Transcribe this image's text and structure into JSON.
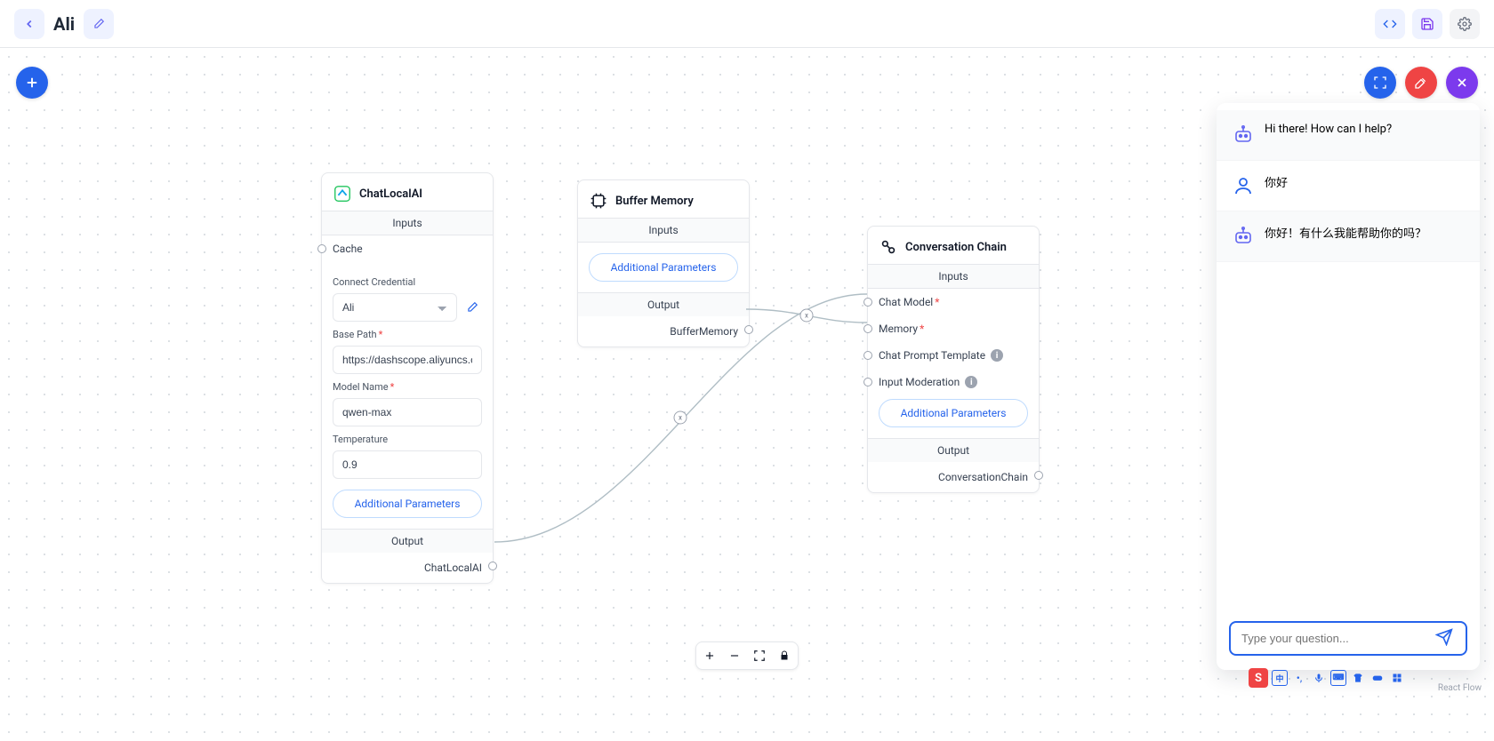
{
  "header": {
    "title": "Ali"
  },
  "canvas": {
    "attribution": "React Flow"
  },
  "nodes": {
    "chatLocalAI": {
      "title": "ChatLocalAI",
      "inputs_label": "Inputs",
      "cache_label": "Cache",
      "connect_credential_label": "Connect Credential",
      "credential_value": "Ali",
      "base_path_label": "Base Path",
      "base_path_value": "https://dashscope.aliyuncs.com/comp",
      "model_name_label": "Model Name",
      "model_name_value": "qwen-max",
      "temperature_label": "Temperature",
      "temperature_value": "0.9",
      "additional_params": "Additional Parameters",
      "output_label": "Output",
      "output_name": "ChatLocalAI"
    },
    "bufferMemory": {
      "title": "Buffer Memory",
      "inputs_label": "Inputs",
      "additional_params": "Additional Parameters",
      "output_label": "Output",
      "output_name": "BufferMemory"
    },
    "conversationChain": {
      "title": "Conversation Chain",
      "inputs_label": "Inputs",
      "port_chat_model": "Chat Model",
      "port_memory": "Memory",
      "port_chat_prompt": "Chat Prompt Template",
      "port_moderation": "Input Moderation",
      "additional_params": "Additional Parameters",
      "output_label": "Output",
      "output_name": "ConversationChain"
    }
  },
  "chat": {
    "messages": {
      "m0": "Hi there! How can I help?",
      "m1": "你好",
      "m2": "你好！有什么我能帮助你的吗？"
    },
    "placeholder": "Type your question..."
  },
  "ime": {
    "logo": "S",
    "lang": "中"
  }
}
